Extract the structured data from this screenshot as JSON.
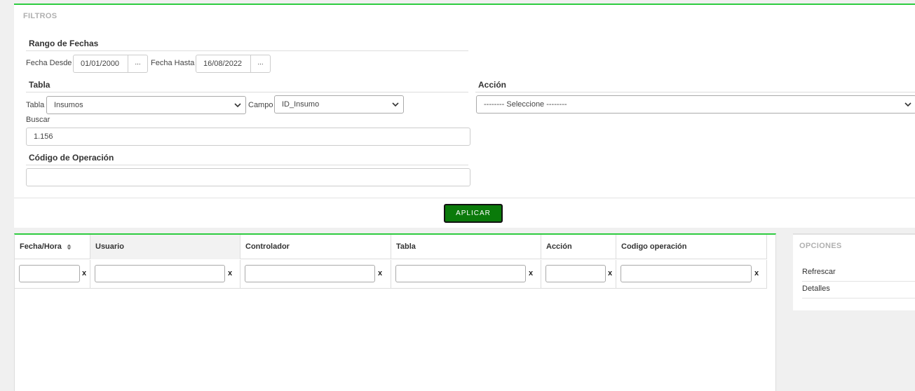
{
  "filters": {
    "title": "FILTROS",
    "date_range": {
      "title": "Rango de Fechas",
      "from_label": "Fecha Desde",
      "from_value": "01/01/2000",
      "to_label": "Fecha Hasta",
      "to_value": "16/08/2022",
      "picker_label": "..."
    },
    "table_section": {
      "title": "Tabla",
      "table_label": "Tabla",
      "table_value": "Insumos",
      "field_label": "Campo",
      "field_value": "ID_Insumo",
      "search_label": "Buscar",
      "search_value": "1.156"
    },
    "action_section": {
      "title": "Acción",
      "select_value": "-------- Seleccione --------"
    },
    "operation_section": {
      "title": "Código de Operación",
      "value": ""
    },
    "apply_label": "APLICAR"
  },
  "grid": {
    "columns": [
      "Fecha/Hora",
      "Usuario",
      "Controlador",
      "Tabla",
      "Acción",
      "Codigo operación"
    ],
    "clear_label": "x",
    "sort_icon": "sort-icon"
  },
  "options": {
    "title": "OPCIONES",
    "items": [
      "Refrescar",
      "Detalles"
    ]
  },
  "colors": {
    "accent": "#2ecc40",
    "apply_bg": "#0a7a0a"
  }
}
